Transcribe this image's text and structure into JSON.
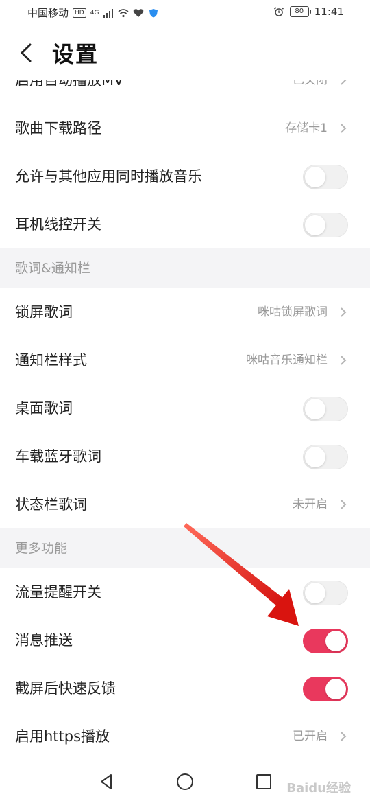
{
  "status_bar": {
    "carrier": "中国移动",
    "hd_tag": "HD",
    "net_tag": "4G",
    "battery": "80",
    "time": "11:41"
  },
  "header": {
    "title": "设置"
  },
  "partial_item": {
    "label": "启用自动播放MV",
    "value": "已关闭"
  },
  "rows_group1": [
    {
      "label": "歌曲下载路径",
      "value": "存储卡1",
      "type": "link"
    },
    {
      "label": "允许与其他应用同时播放音乐",
      "type": "toggle",
      "on": false
    },
    {
      "label": "耳机线控开关",
      "type": "toggle",
      "on": false
    }
  ],
  "section2": {
    "title": "歌词&通知栏"
  },
  "rows_group2": [
    {
      "label": "锁屏歌词",
      "value": "咪咕锁屏歌词",
      "type": "link"
    },
    {
      "label": "通知栏样式",
      "value": "咪咕音乐通知栏",
      "type": "link"
    },
    {
      "label": "桌面歌词",
      "type": "toggle",
      "on": false
    },
    {
      "label": "车载蓝牙歌词",
      "type": "toggle",
      "on": false
    },
    {
      "label": "状态栏歌词",
      "value": "未开启",
      "type": "link"
    }
  ],
  "section3": {
    "title": "更多功能"
  },
  "rows_group3": [
    {
      "label": "流量提醒开关",
      "type": "toggle",
      "on": false
    },
    {
      "label": "消息推送",
      "type": "toggle",
      "on": true
    },
    {
      "label": "截屏后快速反馈",
      "type": "toggle",
      "on": true
    },
    {
      "label": "启用https播放",
      "value": "已开启",
      "type": "link"
    }
  ],
  "nav": {
    "back_icon": "triangle-back-icon",
    "home_icon": "circle-home-icon",
    "recent_icon": "square-recent-icon"
  },
  "watermark": "Baidu经验",
  "colors": {
    "accent": "#e9385d",
    "arrow": "#e8231f",
    "section_bg": "#f4f4f6",
    "muted_text": "#9a9a9a"
  }
}
